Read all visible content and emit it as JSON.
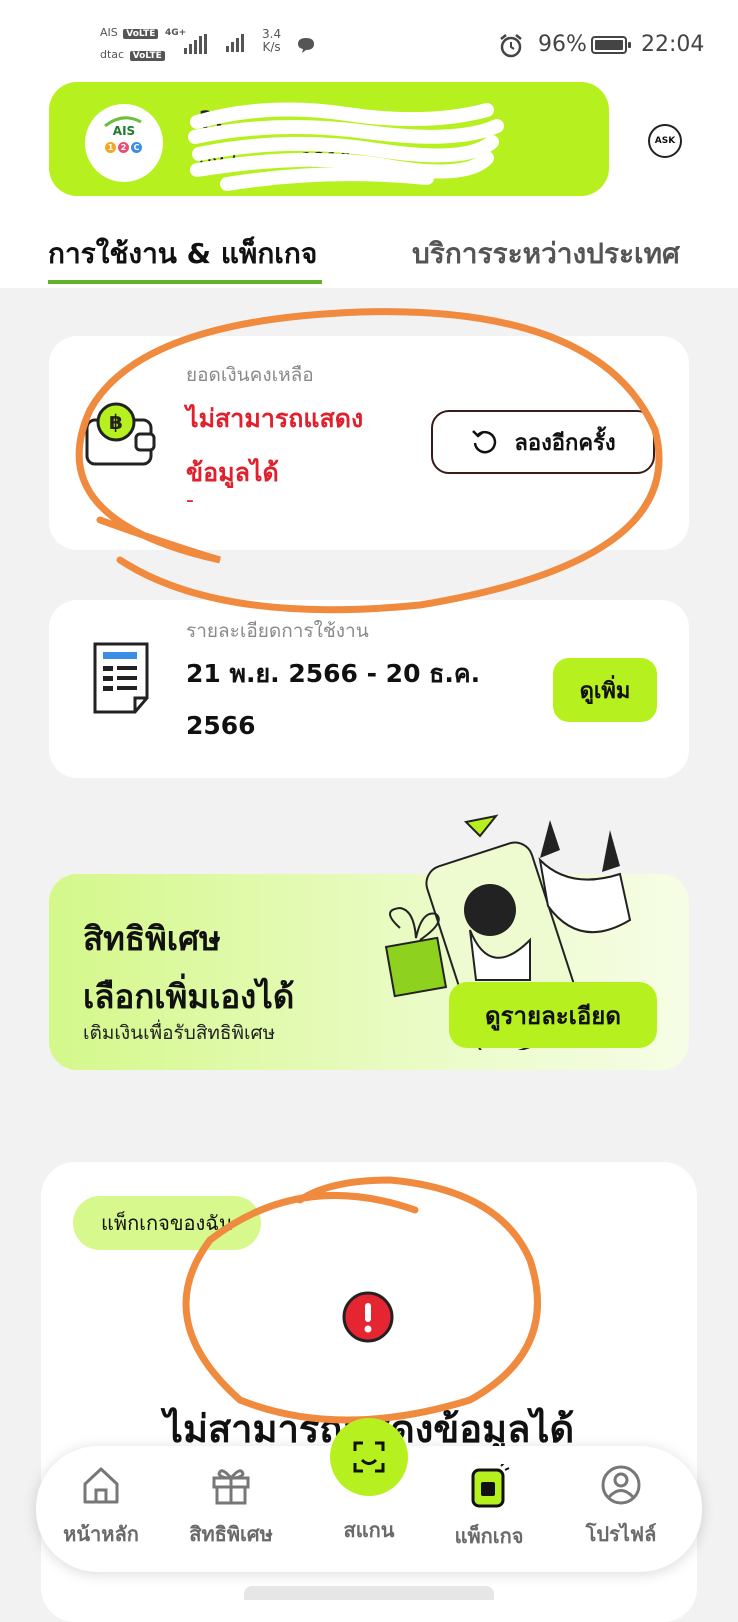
{
  "status_bar": {
    "carrier1": "AIS",
    "carrier2": "dtac",
    "volte": "VoLTE",
    "net_type": "4G+",
    "speed_value": "3.4",
    "speed_unit": "K/s",
    "battery": "96%",
    "time": "22:04"
  },
  "header": {
    "logo_text": "AIS",
    "logo_badge": [
      "1",
      "2",
      "C"
    ],
    "user_name": "??",
    "user_phone": "092 - xx - 1210",
    "ask_label": "ASK"
  },
  "tabs": [
    {
      "label": "การใช้งาน & แพ็กเกจ",
      "active": true
    },
    {
      "label": "บริการระหว่างประเทศ",
      "active": false
    }
  ],
  "balance": {
    "label": "ยอดเงินคงเหลือ",
    "error_text": "ไม่สามารถแสดงข้อมูลได้",
    "value": "-",
    "retry_label": "ลองอีกครั้ง"
  },
  "usage": {
    "label": "รายละเอียดการใช้งาน",
    "date_range": "21 พ.ย. 2566 - 20 ธ.ค. 2566",
    "more_label": "ดูเพิ่ม"
  },
  "promo": {
    "title_line1": "สิทธิพิเศษ",
    "title_line2": "เลือกเพิ่มเองได้",
    "subtitle": "เติมเงินเพื่อรับสิทธิพิเศษ",
    "button_label": "ดูรายละเอียด"
  },
  "packages": {
    "tag": "แพ็กเกจของฉัน",
    "error_text": "ไม่สามารถแสดงข้อมูลได้"
  },
  "bottom_nav": {
    "items": [
      {
        "label": "หน้าหลัก",
        "icon": "home-icon"
      },
      {
        "label": "สิทธิพิเศษ",
        "icon": "gift-icon"
      },
      {
        "label": "สแกน",
        "icon": "scan-icon"
      },
      {
        "label": "แพ็กเกจ",
        "icon": "sim-package-icon",
        "active": true
      },
      {
        "label": "โปรไฟล์",
        "icon": "profile-icon"
      }
    ]
  },
  "colors": {
    "brand_green": "#b6f11f",
    "error_red": "#e0202c",
    "tab_underline": "#61b229",
    "annotation_orange": "#f08a3e"
  }
}
